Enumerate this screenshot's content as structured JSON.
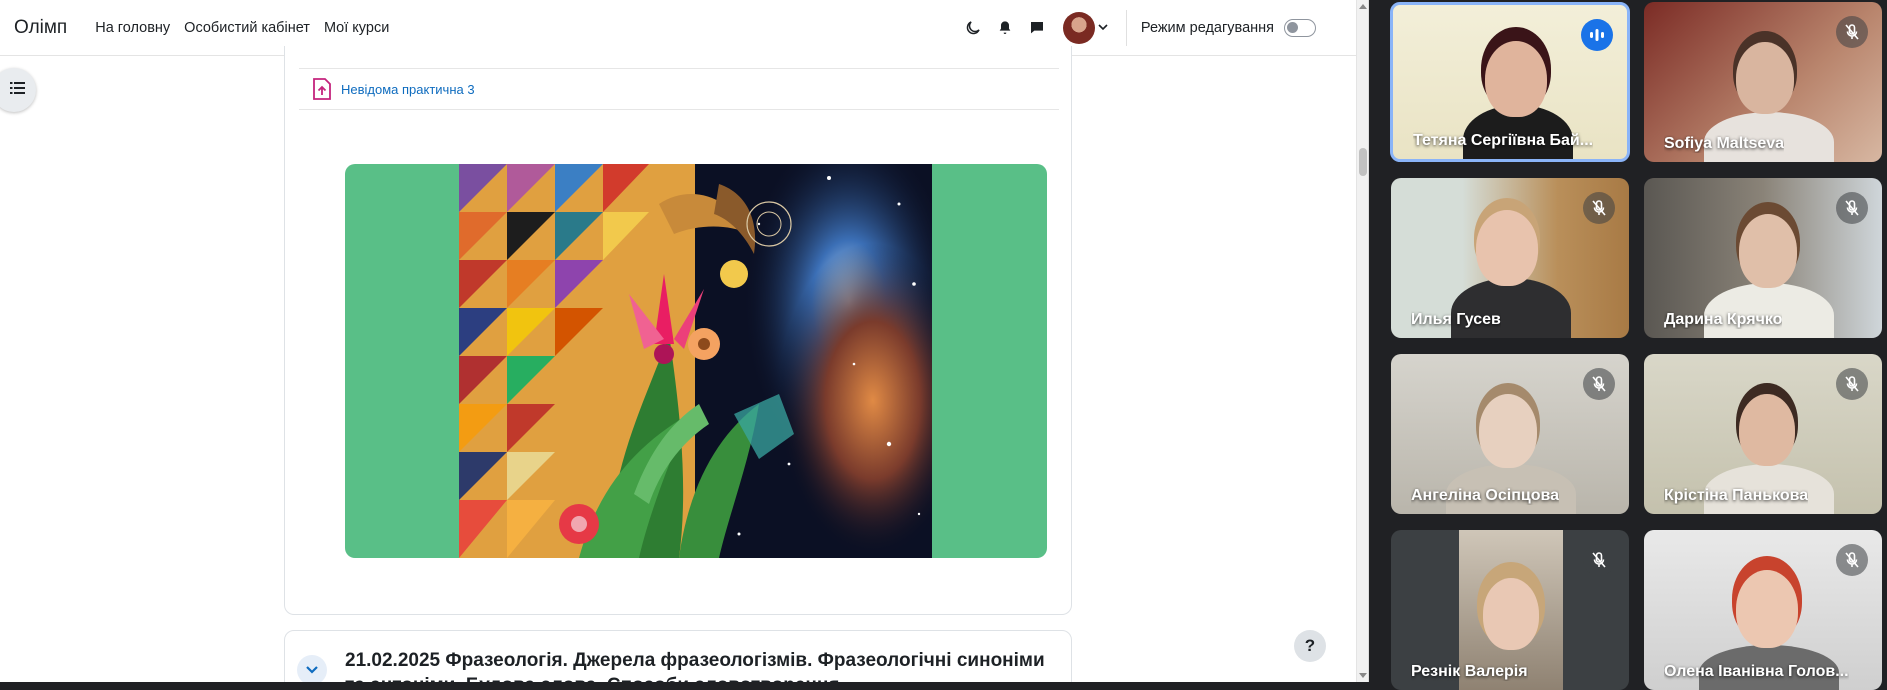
{
  "moodle": {
    "brand": "Олімп",
    "nav_links": [
      "На головну",
      "Особистий кабінет",
      "Мої курси"
    ],
    "edit_mode_label": "Режим редагування",
    "edit_mode_on": false,
    "activity_title": "Невідома практична 3",
    "next_section_title": "21.02.2025 Фразеологія. Джерела фразеологізмів. Фразеологічні синоніми та антоніми. Будова слова. Способи словотворення",
    "help_label": "?"
  },
  "meet": {
    "participants": [
      {
        "name": "Тетяна Сергіївна Бай...",
        "muted": false,
        "speaking": true
      },
      {
        "name": "Sofiya Maltseva",
        "muted": true,
        "speaking": false
      },
      {
        "name": "Илья Гусев",
        "muted": true,
        "speaking": false
      },
      {
        "name": "Дарина Крячко",
        "muted": true,
        "speaking": false
      },
      {
        "name": "Ангеліна Осіпцова",
        "muted": true,
        "speaking": false
      },
      {
        "name": "Крістіна Панькова",
        "muted": true,
        "speaking": false
      },
      {
        "name": "Резнік Валерія",
        "muted": true,
        "speaking": false
      },
      {
        "name": "Олена Іванівна Голов...",
        "muted": true,
        "speaking": false
      }
    ]
  },
  "colors": {
    "moodle_link": "#0f6cbf",
    "banner_green": "#59bf87",
    "meet_background": "#202124",
    "active_speaker_border": "#8ab4f8",
    "speaking_badge": "#1a73e8"
  },
  "icons": [
    "dark-mode-icon",
    "bell-icon",
    "chat-icon",
    "chevron-down-icon",
    "list-icon",
    "assignment-upload-icon",
    "help-icon",
    "mic-off-icon",
    "audio-wave-icon"
  ]
}
